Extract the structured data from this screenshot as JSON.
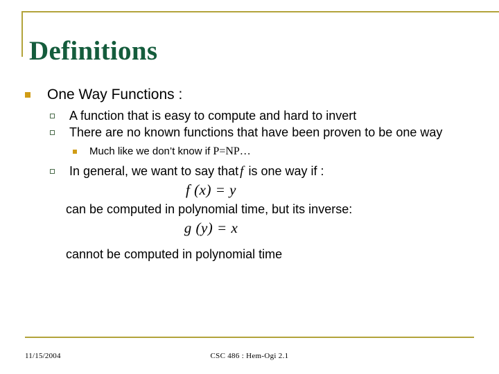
{
  "slide": {
    "title": "Definitions",
    "accent_gold": "#b2a33a",
    "title_green": "#145c3c",
    "bullet_gold": "#d09c16",
    "bullet_hollow_outline": "#4a6b4a"
  },
  "content": {
    "level1": {
      "text": "One Way Functions :",
      "bullet": "filled-square-icon"
    },
    "items": [
      {
        "level": 2,
        "bullet": "hollow-square-icon",
        "text": "A function that is easy to compute and hard to invert"
      },
      {
        "level": 2,
        "bullet": "hollow-square-icon",
        "text": "There are no known functions that have been proven to be one way"
      },
      {
        "level": 3,
        "bullet": "small-filled-square-icon",
        "text_sans": "Much like we don’t know if ",
        "text_serif": "P=NP…"
      },
      {
        "level": 2,
        "bullet": "hollow-square-icon",
        "text_before": "In general, we want to say that",
        "text_math": "f",
        "text_after": "is one way if :"
      }
    ],
    "equation_1": "f (x) = y",
    "continuation_1": "can be computed in polynomial time, but its inverse:",
    "equation_2": "g (y) = x",
    "continuation_2": "cannot be computed in polynomial time"
  },
  "footer": {
    "date": "11/15/2004",
    "center": "CSC 486 : Hem-Ogi 2.1"
  }
}
